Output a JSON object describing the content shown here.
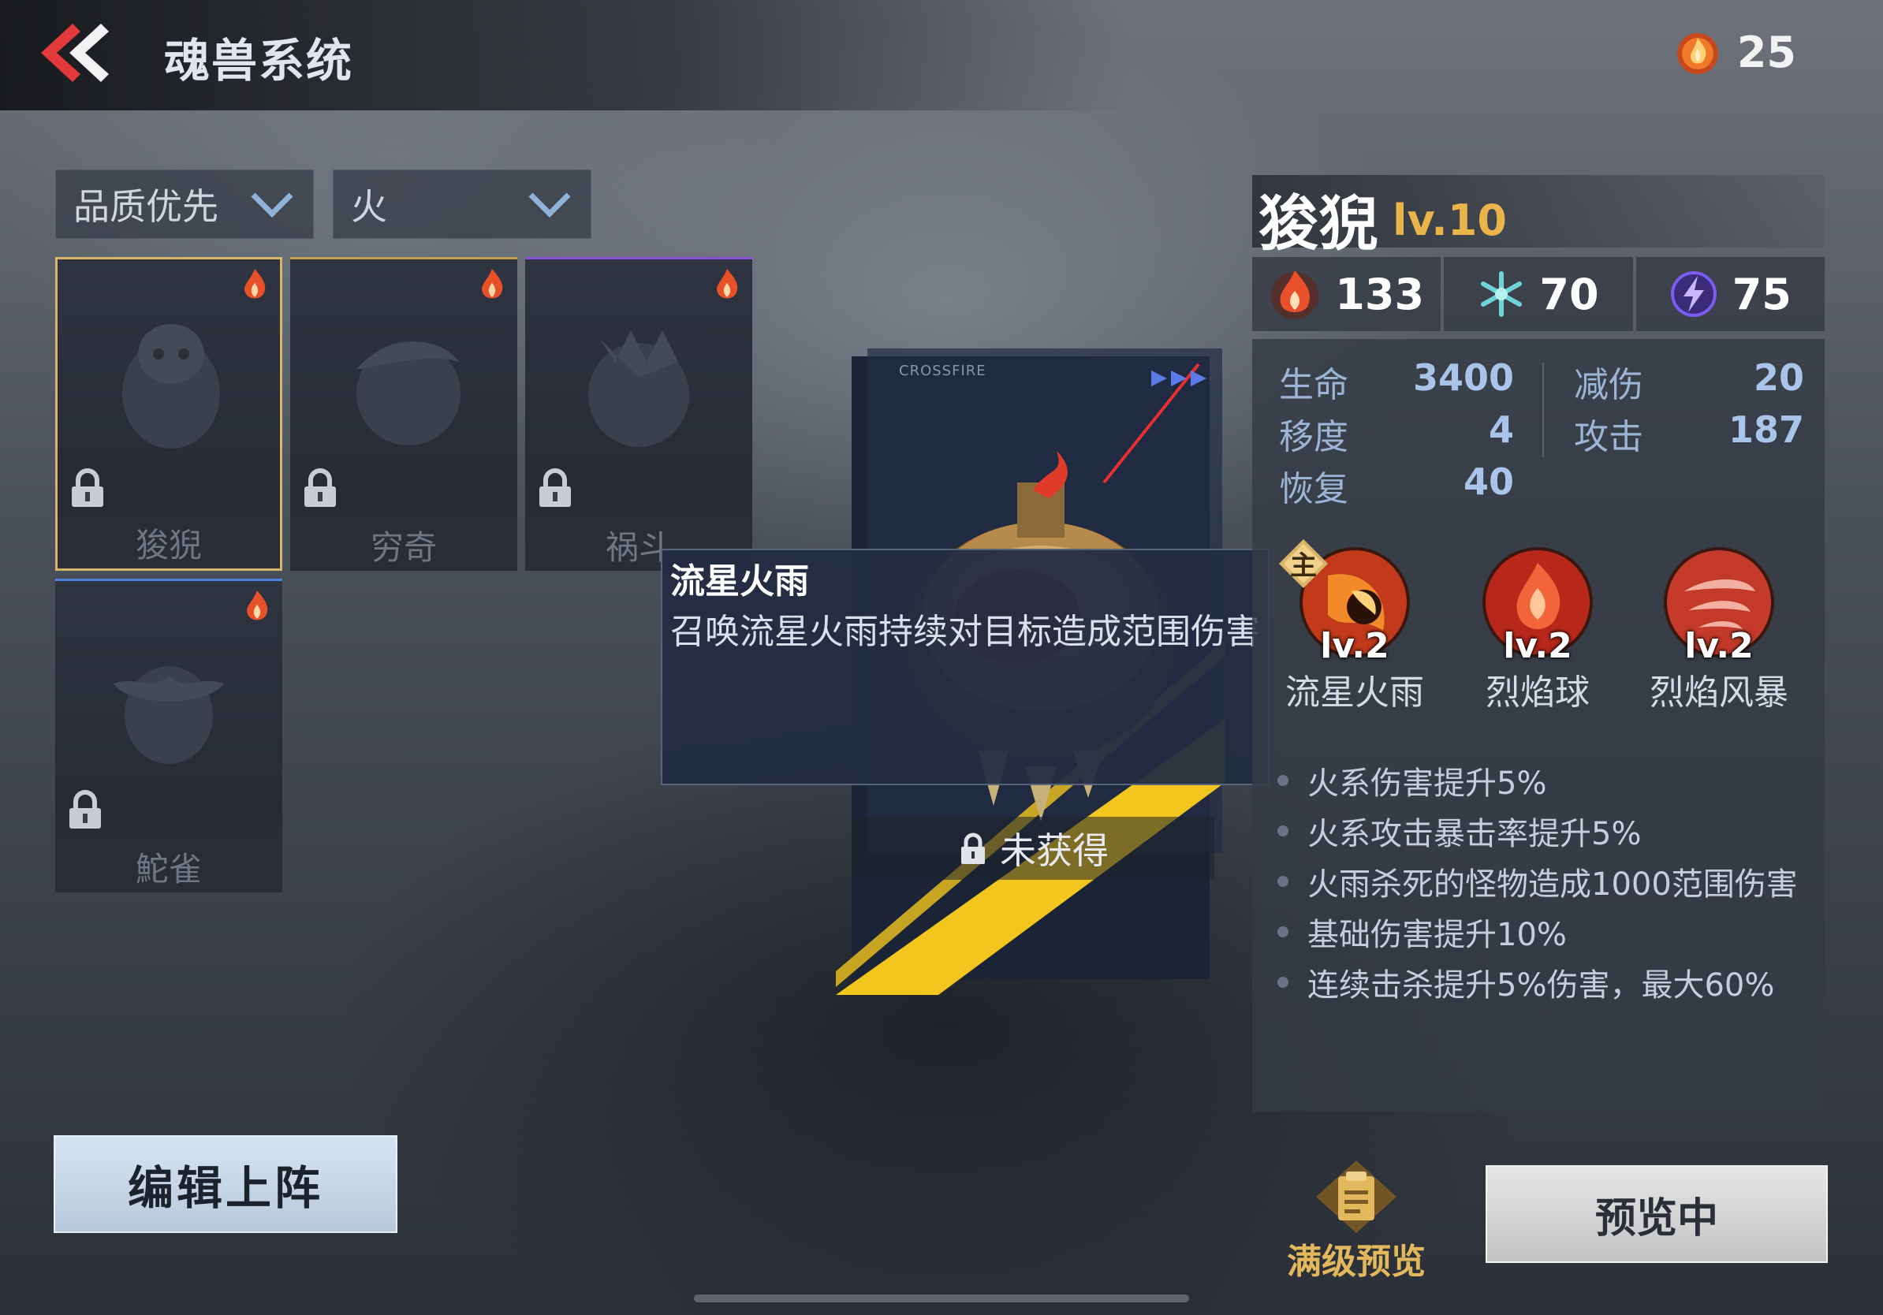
{
  "header": {
    "title": "魂兽系统",
    "currency_value": "25"
  },
  "filters": {
    "quality": "品质优先",
    "element": "火"
  },
  "beasts": [
    {
      "name": "狻猊"
    },
    {
      "name": "穷奇"
    },
    {
      "name": "祸斗"
    },
    {
      "name": "鮀雀"
    }
  ],
  "edit_button": "编辑上阵",
  "item": {
    "brand": "CROSSFIRE",
    "status": "未获得"
  },
  "tooltip": {
    "title": "流星火雨",
    "desc": "召唤流星火雨持续对目标造成范围伤害"
  },
  "detail": {
    "name": "狻猊",
    "level": "lv.10",
    "elements": [
      {
        "icon": "fire-element-icon",
        "value": "133"
      },
      {
        "icon": "ice-element-icon",
        "value": "70"
      },
      {
        "icon": "lightning-element-icon",
        "value": "75"
      }
    ],
    "stats": {
      "hp": {
        "label": "生命",
        "value": "3400"
      },
      "speed": {
        "label": "移度",
        "value": "4"
      },
      "recover": {
        "label": "恢复",
        "value": "40"
      },
      "dmg_reduce": {
        "label": "减伤",
        "value": "20"
      },
      "attack": {
        "label": "攻击",
        "value": "187"
      }
    },
    "main_badge": "主",
    "skills": [
      {
        "level": "lv.2",
        "name": "流星火雨"
      },
      {
        "level": "lv.2",
        "name": "烈焰球"
      },
      {
        "level": "lv.2",
        "name": "烈焰风暴"
      }
    ],
    "bonuses": [
      "火系伤害提升5%",
      "火系攻击暴击率提升5%",
      "火雨杀死的怪物造成1000范围伤害",
      "基础伤害提升10%",
      "连续击杀提升5%伤害，最大60%"
    ]
  },
  "buttons": {
    "full_preview": "满级预览",
    "preview": "预览中"
  },
  "colors": {
    "gold": "#e9b54a",
    "fire": "#e8502a",
    "ice": "#6fd4d8",
    "lightning": "#7a5cf0"
  }
}
